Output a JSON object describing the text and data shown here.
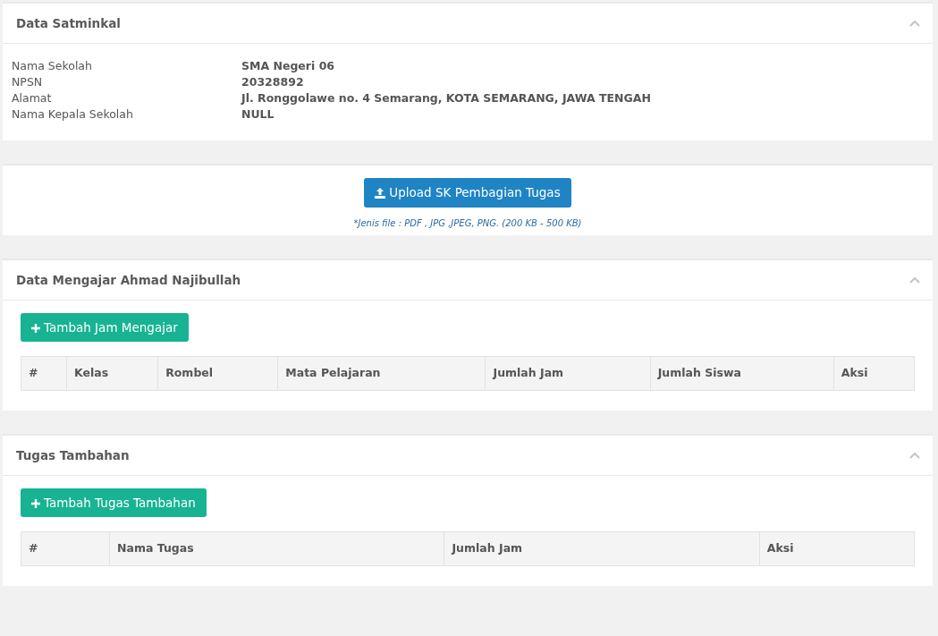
{
  "school_panel": {
    "title": "Data Satminkal",
    "expanded": true,
    "fields": [
      {
        "label": "Nama Sekolah",
        "value": "SMA Negeri 06"
      },
      {
        "label": "NPSN",
        "value": "20328892"
      },
      {
        "label": "Alamat",
        "value": "Jl. Ronggolawe no. 4 Semarang, KOTA SEMARANG, JAWA TENGAH"
      },
      {
        "label": "Nama Kepala Sekolah",
        "value": "NULL"
      }
    ]
  },
  "upload_panel": {
    "button": "Upload SK Pembagian Tugas",
    "note": "*Jenis file : PDF , JPG ,JPEG, PNG. (200 KB - 500 KB)"
  },
  "teaching_panel": {
    "title": "Data Mengajar **Ahmad Najibullah**",
    "expanded": true,
    "button": "Tambah Jam Mengajar",
    "columns": [
      "#",
      "Kelas",
      "Rombel",
      "Mata Pelajaran",
      "Jumlah Jam",
      "Jumlah Siswa",
      "Aksi"
    ]
  },
  "extra_task_panel": {
    "title": "Tugas Tambahan",
    "expanded": true,
    "button": "Tambah Tugas Tambahan",
    "columns": [
      "#",
      "Nama Tugas",
      "Jumlah Jam",
      "Aksi"
    ]
  }
}
